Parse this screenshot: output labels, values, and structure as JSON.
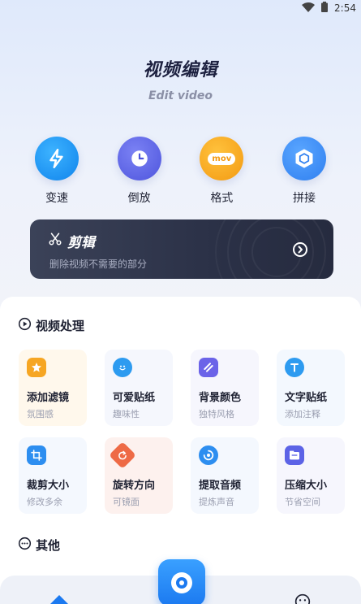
{
  "status_bar": {
    "time": "2:54"
  },
  "hero": {
    "title": "视频编辑",
    "subtitle": "Edit video"
  },
  "quick_actions": [
    {
      "label": "变速",
      "icon": "lightning-icon",
      "color": "#1a8ff0"
    },
    {
      "label": "倒放",
      "icon": "clock-icon",
      "color": "#5c63e6"
    },
    {
      "label": "格式",
      "icon": "mov-icon",
      "badge": "mov",
      "color": "#f7a51c"
    },
    {
      "label": "拼接",
      "icon": "cube-icon",
      "color": "#3d8cf3"
    }
  ],
  "cut_card": {
    "title": "剪辑",
    "description": "删除视频不需要的部分",
    "icon": "scissors-icon"
  },
  "video_section": {
    "title": "视频处理",
    "tools": [
      {
        "name": "添加滤镜",
        "desc": "氛围感",
        "icon": "star-filter-icon",
        "tile_color": "#fff8ec",
        "icon_color": "#f6a623"
      },
      {
        "name": "可爱贴纸",
        "desc": "趣味性",
        "icon": "smiley-sticker-icon",
        "tile_color": "#f5f7fd",
        "icon_color": "#2d9bf0"
      },
      {
        "name": "背景颜色",
        "desc": "独特风格",
        "icon": "palette-icon",
        "tile_color": "#f6f6fd",
        "icon_color": "#6b63e8"
      },
      {
        "name": "文字贴纸",
        "desc": "添加注释",
        "icon": "text-t-icon",
        "tile_color": "#f3f8fe",
        "icon_color": "#2d9bf0"
      },
      {
        "name": "裁剪大小",
        "desc": "修改多余",
        "icon": "crop-icon",
        "tile_color": "#f4f8fe",
        "icon_color": "#2d8ef0"
      },
      {
        "name": "旋转方向",
        "desc": "可镜面",
        "icon": "rotate-icon",
        "tile_color": "#fdf1ee",
        "icon_color": "#ee6a45"
      },
      {
        "name": "提取音频",
        "desc": "提炼声音",
        "icon": "audio-icon",
        "tile_color": "#f4f8fe",
        "icon_color": "#2d8ef0"
      },
      {
        "name": "压缩大小",
        "desc": "节省空间",
        "icon": "compress-folder-icon",
        "tile_color": "#f6f6fd",
        "icon_color": "#5c63e6"
      }
    ]
  },
  "other_section": {
    "title": "其他"
  },
  "bottom_nav": {
    "left_icon": "home-icon",
    "center_icon": "camera-lens-icon",
    "right_icon": "smiley-icon"
  }
}
